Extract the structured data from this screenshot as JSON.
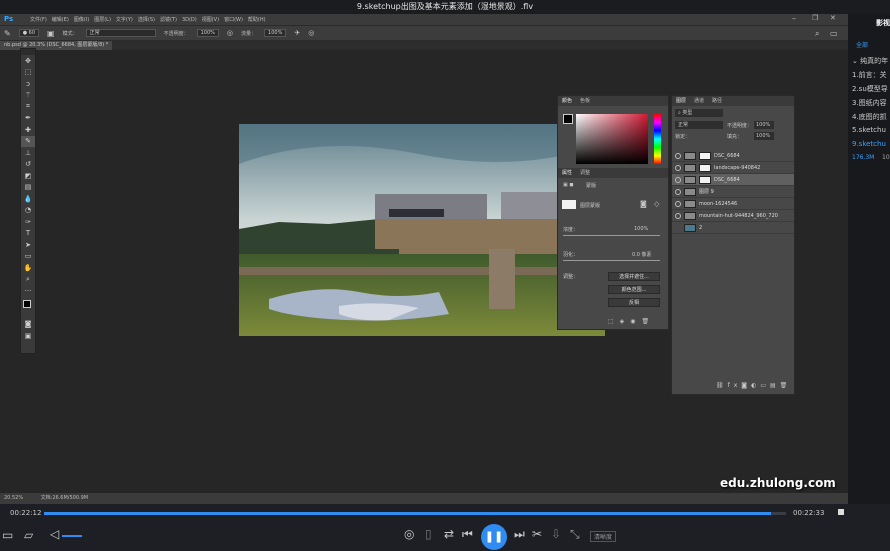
{
  "player": {
    "title": "9.sketchup出图及基本元素添加（湿地景观）.flv",
    "time_current": "00:22:12",
    "time_total": "00:22:33",
    "progress": 0.98,
    "quality_label": "清晰度"
  },
  "photoshop": {
    "menu": [
      "文件(F)",
      "编辑(E)",
      "图像(I)",
      "图层(L)",
      "文字(Y)",
      "选择(S)",
      "滤镜(T)",
      "3D(D)",
      "视图(V)",
      "窗口(W)",
      "帮助(H)"
    ],
    "options": {
      "mode_label": "模式：",
      "mode_value": "正常",
      "opacity_label": "不透明度：",
      "opacity_value": "100%",
      "flow_label": "流量：",
      "flow_value": "100%"
    },
    "doc_tab": "nb.psd @ 20.3% (DSC_6684, 图层蒙版/8) *",
    "status_zoom": "20.52%",
    "status_doc": "文档:26.6M/500.9M",
    "color_panel": {
      "tab1": "颜色",
      "tab2": "色板"
    },
    "properties_panel": {
      "tab1": "属性",
      "tab2": "调整",
      "title": "蒙版",
      "mask_label": "图层蒙版",
      "density_label": "浓度：",
      "density_value": "100%",
      "feather_label": "羽化：",
      "feather_value": "0.0 像素",
      "adjust_label": "调整：",
      "btn_edge": "选择并遮住...",
      "btn_color": "颜色范围...",
      "btn_invert": "反相"
    },
    "layers_panel": {
      "tab1": "图层",
      "tab2": "通道",
      "tab3": "路径",
      "filter_value": "类型",
      "blend_value": "正常",
      "opacity_label": "不透明度：",
      "opacity_value": "100%",
      "lock_label": "锁定：",
      "fill_label": "填充：",
      "fill_value": "100%",
      "layers": [
        {
          "name": "DSC_6684",
          "mask": true
        },
        {
          "name": "landscape-940842",
          "mask": true
        },
        {
          "name": "DSC_6684",
          "mask": true,
          "selected": true
        },
        {
          "name": "图层 9",
          "mask": false
        },
        {
          "name": "moon-1624546",
          "mask": false
        },
        {
          "name": "mountain-hut-944824_960_720",
          "mask": false
        },
        {
          "name": "2",
          "mask": false
        }
      ]
    }
  },
  "sidebar": {
    "header": "影视",
    "tab_all": "全部",
    "items": [
      "纯真的年",
      "1.前言：关",
      "2.su模型导",
      "3.图纸内容",
      "4.底图的抓",
      "5.sketchu",
      "9.sketchu"
    ],
    "size": "176.3M",
    "size2": "10"
  },
  "watermark": "edu.zhulong.com",
  "colors": {
    "accent": "#2f8cf0",
    "sidebar_active": "#3aa0ff"
  }
}
